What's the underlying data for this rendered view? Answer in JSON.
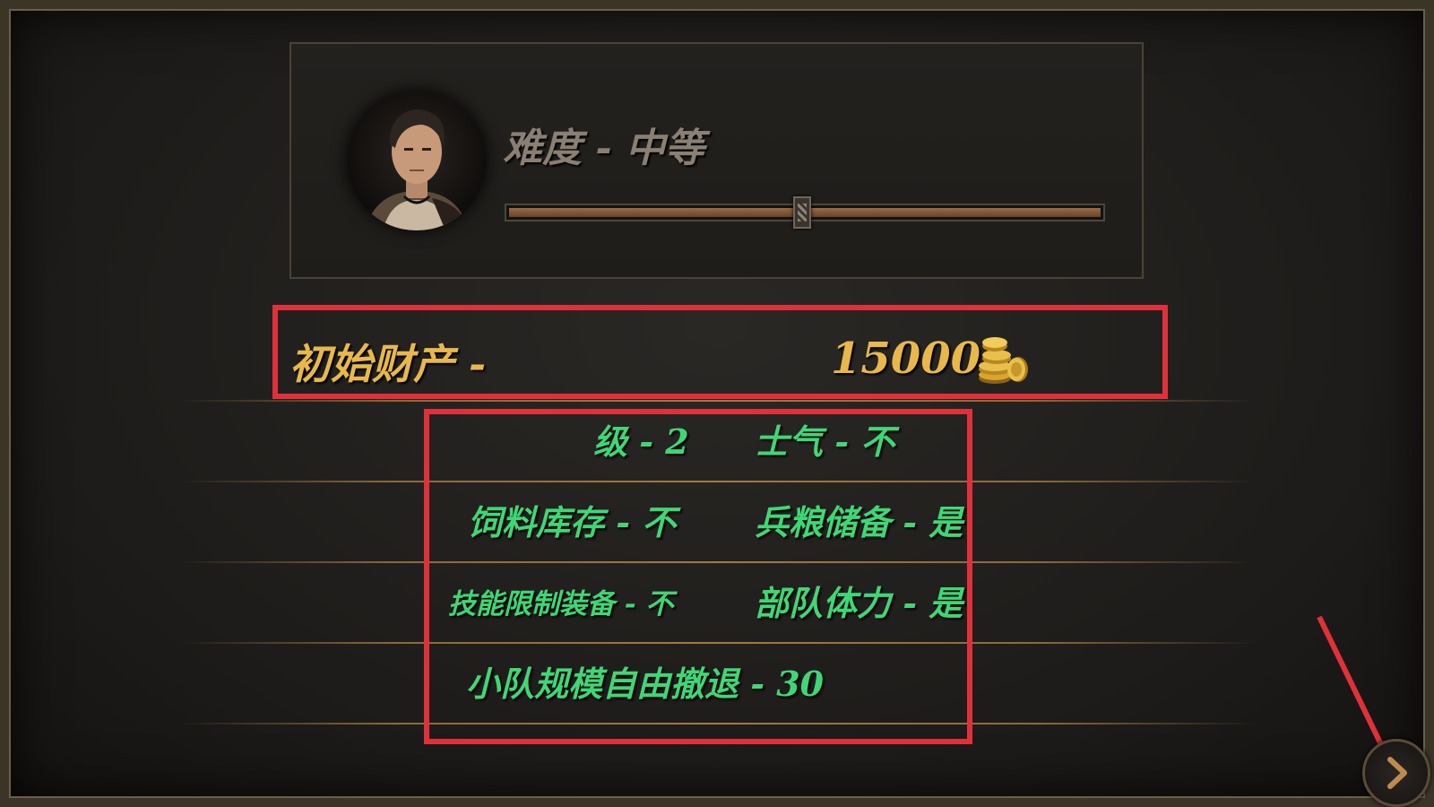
{
  "difficulty": {
    "label": "难度 - 中等",
    "slider_value": 0.5
  },
  "starting_wealth": {
    "label": "初始财产 -",
    "value": "15000",
    "icon": "gold-coins-icon"
  },
  "options": {
    "level": "级 - 2",
    "morale": "士气 - 不",
    "forage_stock": "饲料库存 - 不",
    "rations_reserve": "兵粮储备 - 是",
    "skill_limit_equipment": "技能限制装备 - 不",
    "troop_stamina": "部队体力 - 是",
    "squad_size_free_retreat": "小队规模自由撤退 - 30"
  },
  "navigation": {
    "next_icon": "chevron-right-icon"
  },
  "colors": {
    "accent_gold": "#e8b84a",
    "option_green": "#3fd776",
    "highlight_red": "#e0313a",
    "label_grey": "#8a7f73"
  }
}
